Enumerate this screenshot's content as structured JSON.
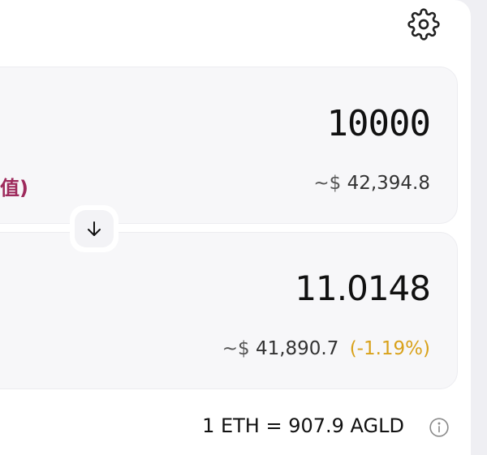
{
  "icons": {
    "settings": "gear-icon",
    "swap": "arrow-down-icon",
    "info": "info-icon"
  },
  "from": {
    "label_fragment": "值)",
    "amount": "10000",
    "fiat_prefix": "~$",
    "fiat_value": "42,394.8"
  },
  "to": {
    "amount": "11.0148",
    "fiat_prefix": "~$",
    "fiat_value": "41,890.7",
    "change": "(-1.19%)"
  },
  "rate": "1 ETH = 907.9 AGLD",
  "colors": {
    "accent_label": "#9e2a5c",
    "change": "#d9a21b"
  }
}
